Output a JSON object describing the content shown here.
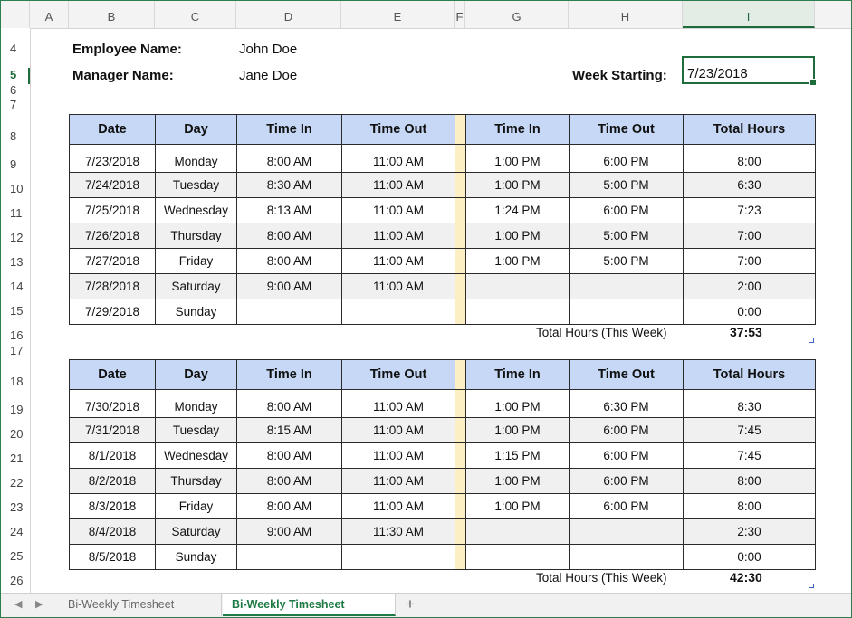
{
  "columns": [
    "A",
    "B",
    "C",
    "D",
    "E",
    "F",
    "G",
    "H",
    "I"
  ],
  "active_column": "I",
  "rows": [
    "4",
    "5",
    "6",
    "7",
    "8",
    "9",
    "10",
    "11",
    "12",
    "13",
    "14",
    "15",
    "16",
    "17",
    "18",
    "19",
    "20",
    "21",
    "22",
    "23",
    "24",
    "25",
    "26"
  ],
  "active_row": "5",
  "info": {
    "employee_label": "Employee Name:",
    "employee_value": "John Doe",
    "manager_label": "Manager Name:",
    "manager_value": "Jane Doe",
    "week_label": "Week Starting:",
    "week_value": "7/23/2018"
  },
  "headers": [
    "Date",
    "Day",
    "Time In",
    "Time Out",
    "Time In",
    "Time Out",
    "Total Hours"
  ],
  "week1": {
    "rows": [
      [
        "7/23/2018",
        "Monday",
        "8:00 AM",
        "11:00 AM",
        "1:00 PM",
        "6:00 PM",
        "8:00"
      ],
      [
        "7/24/2018",
        "Tuesday",
        "8:30 AM",
        "11:00 AM",
        "1:00 PM",
        "5:00 PM",
        "6:30"
      ],
      [
        "7/25/2018",
        "Wednesday",
        "8:13 AM",
        "11:00 AM",
        "1:24 PM",
        "6:00 PM",
        "7:23"
      ],
      [
        "7/26/2018",
        "Thursday",
        "8:00 AM",
        "11:00 AM",
        "1:00 PM",
        "5:00 PM",
        "7:00"
      ],
      [
        "7/27/2018",
        "Friday",
        "8:00 AM",
        "11:00 AM",
        "1:00 PM",
        "5:00 PM",
        "7:00"
      ],
      [
        "7/28/2018",
        "Saturday",
        "9:00 AM",
        "11:00 AM",
        "",
        "",
        "2:00"
      ],
      [
        "7/29/2018",
        "Sunday",
        "",
        "",
        "",
        "",
        "0:00"
      ]
    ],
    "total_label": "Total Hours (This Week)",
    "total_value": "37:53"
  },
  "week2": {
    "rows": [
      [
        "7/30/2018",
        "Monday",
        "8:00 AM",
        "11:00 AM",
        "1:00 PM",
        "6:30 PM",
        "8:30"
      ],
      [
        "7/31/2018",
        "Tuesday",
        "8:15 AM",
        "11:00 AM",
        "1:00 PM",
        "6:00 PM",
        "7:45"
      ],
      [
        "8/1/2018",
        "Wednesday",
        "8:00 AM",
        "11:00 AM",
        "1:15 PM",
        "6:00 PM",
        "7:45"
      ],
      [
        "8/2/2018",
        "Thursday",
        "8:00 AM",
        "11:00 AM",
        "1:00 PM",
        "6:00 PM",
        "8:00"
      ],
      [
        "8/3/2018",
        "Friday",
        "8:00 AM",
        "11:00 AM",
        "1:00 PM",
        "6:00 PM",
        "8:00"
      ],
      [
        "8/4/2018",
        "Saturday",
        "9:00 AM",
        "11:30 AM",
        "",
        "",
        "2:30"
      ],
      [
        "8/5/2018",
        "Sunday",
        "",
        "",
        "",
        "",
        "0:00"
      ]
    ],
    "total_label": "Total Hours (This Week)",
    "total_value": "42:30"
  },
  "tabs": {
    "items": [
      "Bi-Weekly Timesheet (Blank)",
      "Bi-Weekly Timesheet Sample"
    ],
    "active": 1,
    "prev_icon": "◀",
    "next_icon": "▶",
    "add_icon": "+"
  },
  "colors": {
    "header_fill": "#c6d8f5",
    "gap_fill": "#fdefc4",
    "alt_row_fill": "#f0f0f0",
    "accent": "#1e6b3c"
  }
}
